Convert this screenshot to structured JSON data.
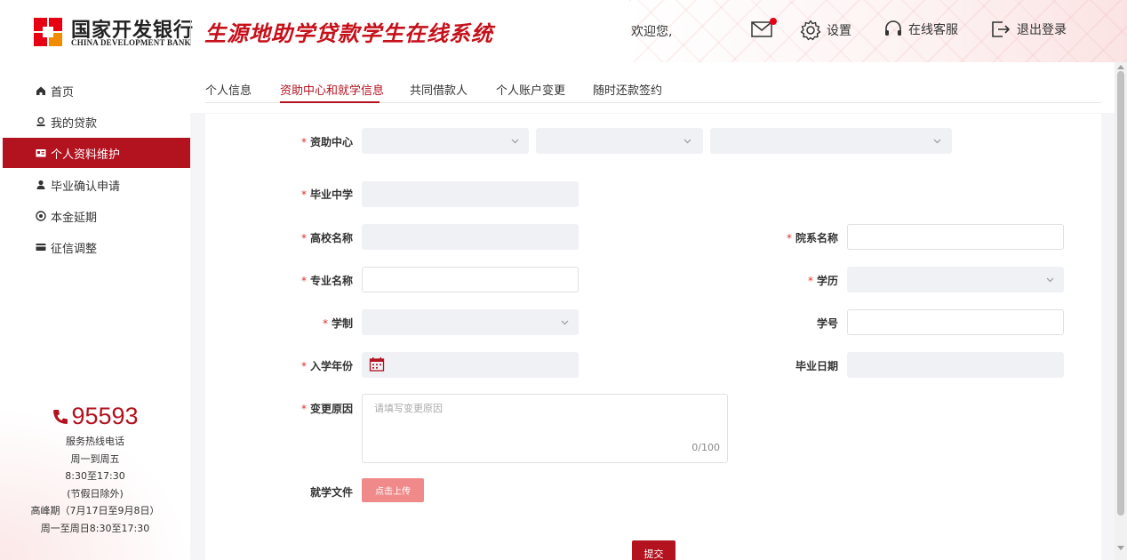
{
  "header": {
    "bank_name_cn": "国家开发银行",
    "bank_name_en": "CHINA DEVELOPMENT BANK",
    "system_title": "生源地助学贷款学生在线系统",
    "welcome": "欢迎您,",
    "settings_label": "设置",
    "service_label": "在线客服",
    "logout_label": "退出登录",
    "brand_color": "#b3121f"
  },
  "sidebar": {
    "items": [
      {
        "label": "首页",
        "icon": "home-icon"
      },
      {
        "label": "我的贷款",
        "icon": "loan-icon"
      },
      {
        "label": "个人资料维护",
        "icon": "profile-card-icon",
        "active": true
      },
      {
        "label": "毕业确认申请",
        "icon": "user-icon"
      },
      {
        "label": "本金延期",
        "icon": "clock-icon"
      },
      {
        "label": "征信调整",
        "icon": "credit-card-icon"
      }
    ],
    "hotline": {
      "number": "95593",
      "lines": [
        "服务热线电话",
        "周一到周五",
        "8:30至17:30",
        "(节假日除外)",
        "高峰期（7月17日至9月8日）",
        "周一至周日8:30至17:30"
      ]
    }
  },
  "tabs": [
    "个人信息",
    "资助中心和就学信息",
    "共同借款人",
    "个人账户变更",
    "随时还款签约"
  ],
  "form": {
    "funding_center": "资助中心",
    "graduated_high_school": "毕业中学",
    "university_name": "高校名称",
    "department_name": "院系名称",
    "major_name": "专业名称",
    "education": "学历",
    "program_length": "学制",
    "student_id": "学号",
    "enrollment_year": "入学年份",
    "graduation_date": "毕业日期",
    "change_reason": "变更原因",
    "change_reason_placeholder": "请填写变更原因",
    "char_count": "0/100",
    "study_document": "就学文件",
    "upload_label": "点击上传",
    "submit_label": "提交"
  }
}
